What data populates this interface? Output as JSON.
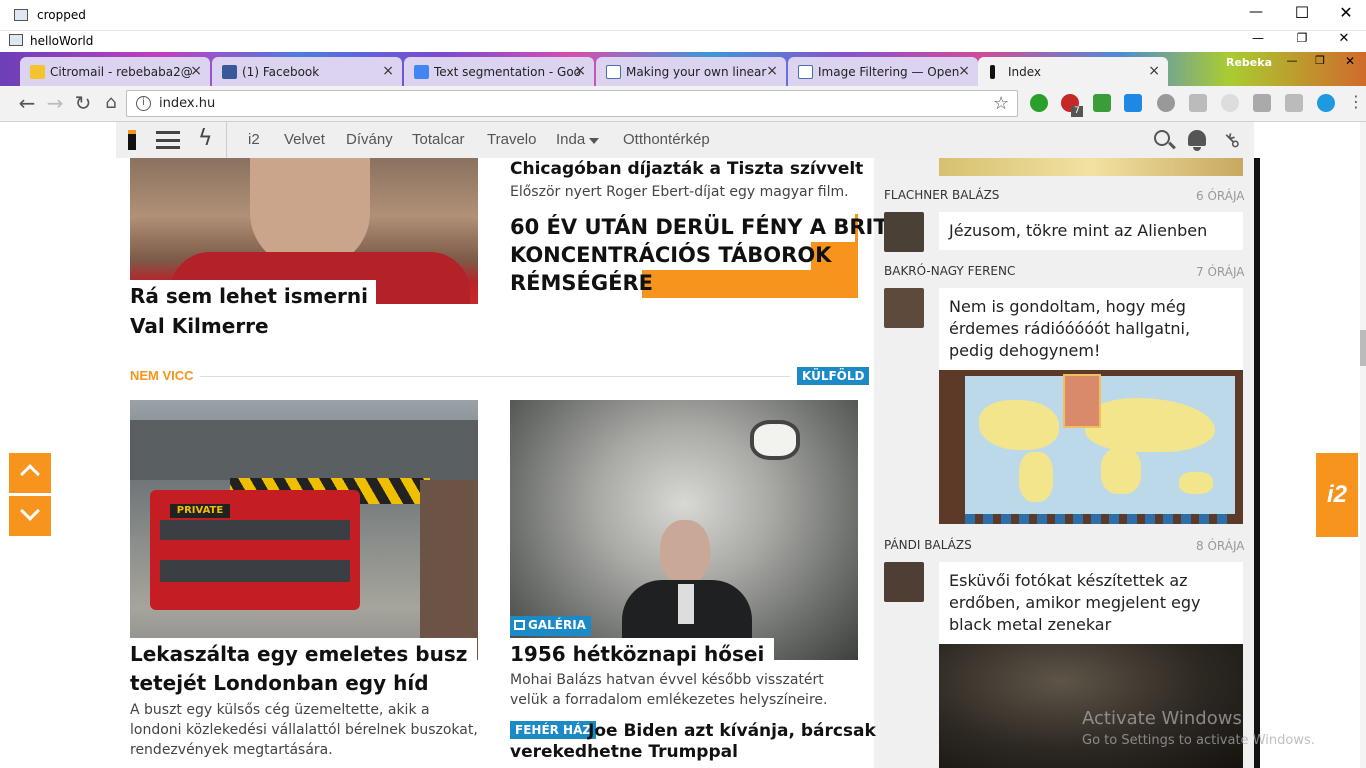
{
  "outer_window": {
    "title": "cropped",
    "controls": [
      "—",
      "☐",
      "✕"
    ]
  },
  "inner_window": {
    "title": "helloWorld"
  },
  "tabs": [
    {
      "label": "Citromail - rebebaba2@",
      "color": "#f4c430"
    },
    {
      "label": "(1) Facebook",
      "color": "#3b5998"
    },
    {
      "label": "Text segmentation - Goo",
      "color": "#4285f4"
    },
    {
      "label": "Making your own linear",
      "color": "#ffffff"
    },
    {
      "label": "Image Filtering — Open",
      "color": "#ffffff"
    },
    {
      "label": "Index",
      "color": "#111111"
    }
  ],
  "profile_name": "Rebeka",
  "address": {
    "url": "index.hu"
  },
  "ext_badge": "7",
  "index_nav": {
    "items": [
      "i2",
      "Velvet",
      "Dívány",
      "Totalcar",
      "Travelo",
      "Inda",
      "Otthontérkép"
    ]
  },
  "articles": {
    "val_kilmer": {
      "title_line1": "Rá sem lehet ismerni",
      "title_line2": "Val Kilmerre"
    },
    "chicago": {
      "title": "Chicagóban díjazták a Tiszta szívvelt",
      "lead": "Először nyert Roger Ebert-díjat egy magyar film."
    },
    "brit": {
      "line1": "60 ÉV UTÁN DERÜL FÉNY A BRIT",
      "line2": "KONCENTRÁCIÓS TÁBOROK",
      "line3": "RÉMSÉGÉRE"
    },
    "section": {
      "label": "NEM VICC",
      "tag": "KÜLFÖLD"
    },
    "bus": {
      "title_line1": "Lekaszálta egy emeletes busz",
      "title_line2": "tetejét Londonban egy híd",
      "lead": "A buszt egy külsős cég üzemeltette, akik a londoni közlekedési vállalattól bérelnek buszokat, rendezvények megtartására.",
      "sign": "PRIVATE"
    },
    "heroes": {
      "badge": "GALÉRIA",
      "title": "1956 hétköznapi hősei",
      "lead": "Mohai Balázs hatvan évvel később visszatért velük a forradalom emlékezetes helyszíneire."
    },
    "biden": {
      "tag": "FEHÉR HÁZ",
      "title_line1": "Joe Biden azt kívánja, bárcsak",
      "title_line2": "verekedhetne Trumppal"
    }
  },
  "feed": [
    {
      "author": "FLACHNER BALÁZS",
      "time": "6 ÓRÁJA",
      "text": "Jézusom, tökre mint az Alienben"
    },
    {
      "author": "BAKRÓ-NAGY FERENC",
      "time": "7 ÓRÁJA",
      "text": "Nem is gondoltam, hogy még érdemes rádióóóóót hallgatni, pedig dehogynem!"
    },
    {
      "author": "PÁNDI BALÁZS",
      "time": "8 ÓRÁJA",
      "text": "Esküvői fotókat készítettek az erdőben, amikor megjelent egy black metal zenekar"
    }
  ],
  "side_widget": {
    "label": "i2"
  },
  "watermark": {
    "line1": "Activate Windows",
    "line2": "Go to Settings to activate Windows."
  }
}
